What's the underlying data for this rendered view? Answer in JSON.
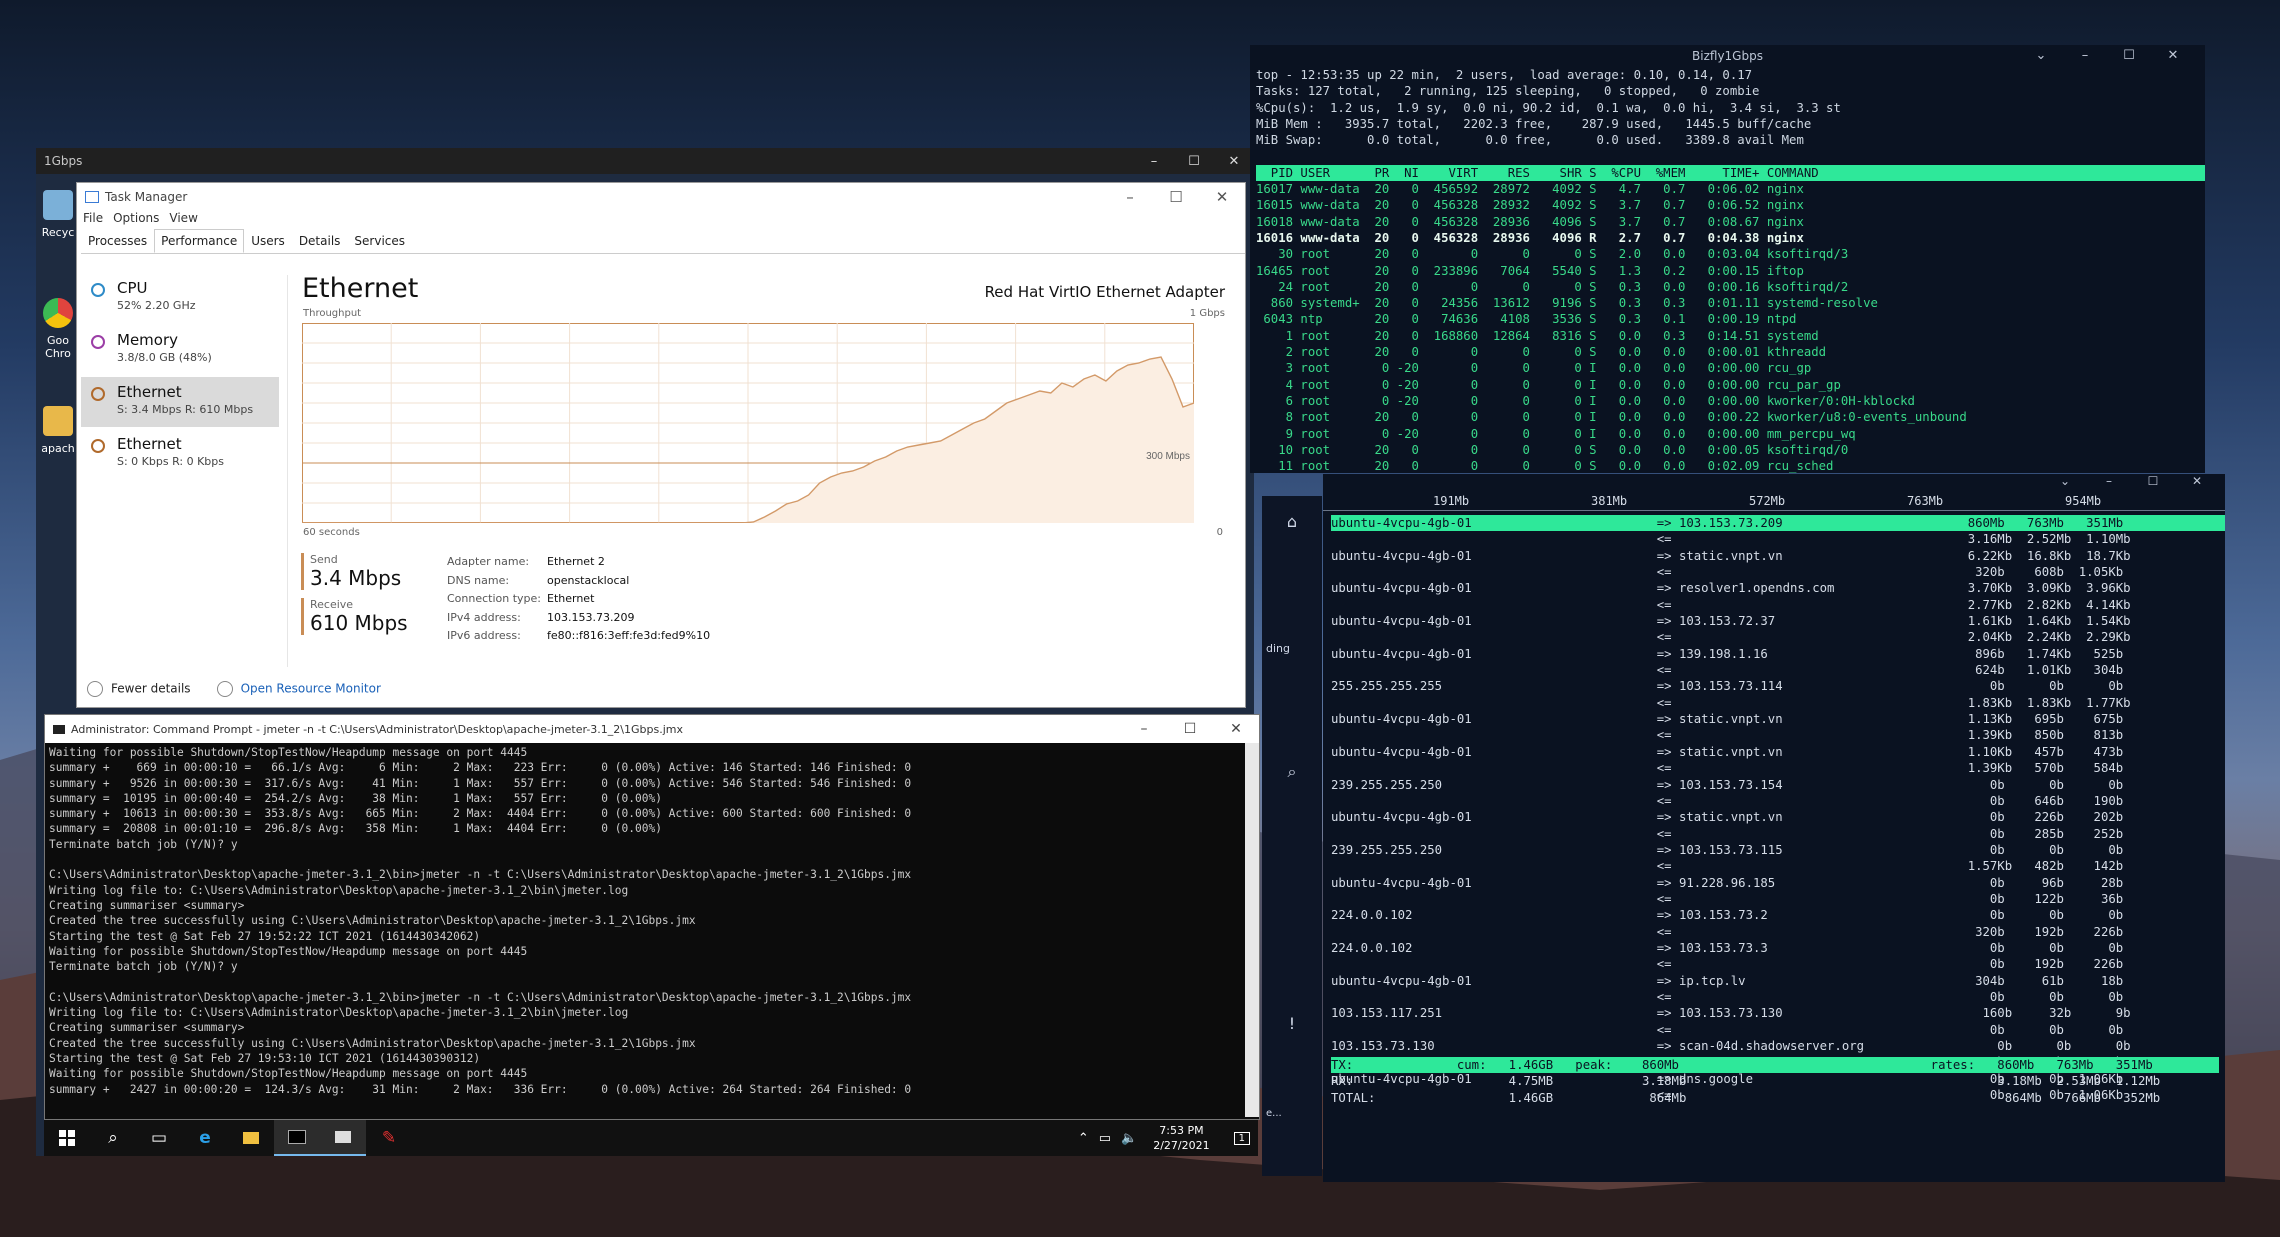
{
  "vm_window": {
    "title": "1Gbps"
  },
  "desktop_icons": [
    {
      "label": "Recyc",
      "color": "#7bb0d8"
    },
    {
      "label": "Goo\nChro",
      "color": "#e0443e"
    },
    {
      "label": "apach",
      "color": "#e8b84a"
    }
  ],
  "task_manager": {
    "title": "Task Manager",
    "menu": [
      "File",
      "Options",
      "View"
    ],
    "tabs": [
      "Processes",
      "Performance",
      "Users",
      "Details",
      "Services"
    ],
    "active_tab": "Performance",
    "resources": [
      {
        "name": "CPU",
        "sub": "52% 2.20 GHz",
        "ring": "#2e8bc8"
      },
      {
        "name": "Memory",
        "sub": "3.8/8.0 GB (48%)",
        "ring": "#9b3ea6"
      },
      {
        "name": "Ethernet",
        "sub": "S: 3.4 Mbps  R: 610 Mbps",
        "ring": "#b06a2c"
      },
      {
        "name": "Ethernet",
        "sub": "S: 0 Kbps  R: 0 Kbps",
        "ring": "#b06a2c"
      }
    ],
    "heading": "Ethernet",
    "adapter": "Red Hat VirtIO Ethernet Adapter",
    "throughput_label": "Throughput",
    "throughput_max": "1 Gbps",
    "scale_marker": "300 Mbps",
    "time_span": "60 seconds",
    "zero": "0",
    "send_label": "Send",
    "send_value": "3.4 Mbps",
    "receive_label": "Receive",
    "receive_value": "610 Mbps",
    "details": [
      {
        "k": "Adapter name:",
        "v": "Ethernet 2"
      },
      {
        "k": "DNS name:",
        "v": "openstacklocal"
      },
      {
        "k": "Connection type:",
        "v": "Ethernet"
      },
      {
        "k": "IPv4 address:",
        "v": "103.153.73.209"
      },
      {
        "k": "IPv6 address:",
        "v": "fe80::f816:3eff:fe3d:fed9%10"
      }
    ],
    "fewer_details": "Fewer details",
    "open_monitor": "Open Resource Monitor",
    "graph_mbps": [
      0,
      0,
      0,
      0,
      0,
      0,
      0,
      0,
      0,
      0,
      0,
      0,
      0,
      0,
      0,
      0,
      0,
      0,
      0,
      0,
      0,
      0,
      0,
      0,
      0,
      0,
      0,
      0,
      0,
      0,
      0,
      0,
      0,
      0,
      0,
      0,
      0,
      0,
      0,
      0,
      0,
      5,
      30,
      60,
      95,
      110,
      140,
      200,
      230,
      250,
      260,
      280,
      310,
      330,
      360,
      380,
      390,
      400,
      410,
      440,
      470,
      500,
      520,
      560,
      600,
      620,
      640,
      660,
      650,
      700,
      680,
      720,
      740,
      710,
      760,
      790,
      800,
      820,
      830,
      720,
      580,
      600
    ]
  },
  "cmd": {
    "title": "Administrator: Command Prompt - jmeter  -n -t C:\\Users\\Administrator\\Desktop\\apache-jmeter-3.1_2\\1Gbps.jmx",
    "lines": [
      "Waiting for possible Shutdown/StopTestNow/Heapdump message on port 4445",
      "summary +    669 in 00:00:10 =   66.1/s Avg:     6 Min:     2 Max:   223 Err:     0 (0.00%) Active: 146 Started: 146 Finished: 0",
      "summary +   9526 in 00:00:30 =  317.6/s Avg:    41 Min:     1 Max:   557 Err:     0 (0.00%) Active: 546 Started: 546 Finished: 0",
      "summary =  10195 in 00:00:40 =  254.2/s Avg:    38 Min:     1 Max:   557 Err:     0 (0.00%)",
      "summary +  10613 in 00:00:30 =  353.8/s Avg:   665 Min:     2 Max:  4404 Err:     0 (0.00%) Active: 600 Started: 600 Finished: 0",
      "summary =  20808 in 00:01:10 =  296.8/s Avg:   358 Min:     1 Max:  4404 Err:     0 (0.00%)",
      "Terminate batch job (Y/N)? y",
      "",
      "C:\\Users\\Administrator\\Desktop\\apache-jmeter-3.1_2\\bin>jmeter -n -t C:\\Users\\Administrator\\Desktop\\apache-jmeter-3.1_2\\1Gbps.jmx",
      "Writing log file to: C:\\Users\\Administrator\\Desktop\\apache-jmeter-3.1_2\\bin\\jmeter.log",
      "Creating summariser <summary>",
      "Created the tree successfully using C:\\Users\\Administrator\\Desktop\\apache-jmeter-3.1_2\\1Gbps.jmx",
      "Starting the test @ Sat Feb 27 19:52:22 ICT 2021 (1614430342062)",
      "Waiting for possible Shutdown/StopTestNow/Heapdump message on port 4445",
      "Terminate batch job (Y/N)? y",
      "",
      "C:\\Users\\Administrator\\Desktop\\apache-jmeter-3.1_2\\bin>jmeter -n -t C:\\Users\\Administrator\\Desktop\\apache-jmeter-3.1_2\\1Gbps.jmx",
      "Writing log file to: C:\\Users\\Administrator\\Desktop\\apache-jmeter-3.1_2\\bin\\jmeter.log",
      "Creating summariser <summary>",
      "Created the tree successfully using C:\\Users\\Administrator\\Desktop\\apache-jmeter-3.1_2\\1Gbps.jmx",
      "Starting the test @ Sat Feb 27 19:53:10 ICT 2021 (1614430390312)",
      "Waiting for possible Shutdown/StopTestNow/Heapdump message on port 4445",
      "summary +   2427 in 00:00:20 =  124.3/s Avg:    31 Min:     2 Max:   336 Err:     0 (0.00%) Active: 264 Started: 264 Finished: 0"
    ]
  },
  "taskbar": {
    "time": "7:53 PM",
    "date": "2/27/2021",
    "notif_count": "1"
  },
  "top_window": {
    "title": "Bizfly1Gbps",
    "summary": [
      "top - 12:53:35 up 22 min,  2 users,  load average: 0.10, 0.14, 0.17",
      "Tasks: 127 total,   2 running, 125 sleeping,   0 stopped,   0 zombie",
      "%Cpu(s):  1.2 us,  1.9 sy,  0.0 ni, 90.2 id,  0.1 wa,  0.0 hi,  3.4 si,  3.3 st",
      "MiB Mem :   3935.7 total,   2202.3 free,    287.9 used,   1445.5 buff/cache",
      "MiB Swap:      0.0 total,      0.0 free,      0.0 used.   3389.8 avail Mem"
    ],
    "header": "  PID USER      PR  NI    VIRT    RES    SHR S  %CPU  %MEM     TIME+ COMMAND                                      ",
    "rows": [
      "16017 www-data  20   0  456592  28972   4092 S   4.7   0.7   0:06.02 nginx",
      "16015 www-data  20   0  456328  28932   4092 S   3.7   0.7   0:06.52 nginx",
      "16018 www-data  20   0  456328  28936   4096 S   3.7   0.7   0:08.67 nginx",
      "16016 www-data  20   0  456328  28936   4096 R   2.7   0.7   0:04.38 nginx",
      "   30 root      20   0       0      0      0 S   2.0   0.0   0:03.04 ksoftirqd/3",
      "16465 root      20   0  233896   7064   5540 S   1.3   0.2   0:00.15 iftop",
      "   24 root      20   0       0      0      0 S   0.3   0.0   0:00.16 ksoftirqd/2",
      "  860 systemd+  20   0   24356  13612   9196 S   0.3   0.3   0:01.11 systemd-resolve",
      " 6043 ntp       20   0   74636   4108   3536 S   0.3   0.1   0:00.19 ntpd",
      "    1 root      20   0  168860  12864   8316 S   0.0   0.3   0:14.51 systemd",
      "    2 root      20   0       0      0      0 S   0.0   0.0   0:00.01 kthreadd",
      "    3 root       0 -20       0      0      0 I   0.0   0.0   0:00.00 rcu_gp",
      "    4 root       0 -20       0      0      0 I   0.0   0.0   0:00.00 rcu_par_gp",
      "    6 root       0 -20       0      0      0 I   0.0   0.0   0:00.00 kworker/0:0H-kblockd",
      "    8 root      20   0       0      0      0 I   0.0   0.0   0:00.22 kworker/u8:0-events_unbound",
      "    9 root       0 -20       0      0      0 I   0.0   0.0   0:00.00 mm_percpu_wq",
      "   10 root      20   0       0      0      0 S   0.0   0.0   0:00.05 ksoftirqd/0",
      "   11 root      20   0       0      0      0 S   0.0   0.0   0:02.09 rcu_sched"
    ]
  },
  "iftop": {
    "scale": [
      "191Mb",
      "381Mb",
      "572Mb",
      "763Mb",
      "954Mb"
    ],
    "lines": [
      "ubuntu-4vcpu-4gb-01                         => 103.153.73.209                         860Mb   763Mb   351Mb",
      "                                            <=                                        3.16Mb  2.52Mb  1.10Mb",
      "ubuntu-4vcpu-4gb-01                         => static.vnpt.vn                         6.22Kb  16.8Kb  18.7Kb",
      "                                            <=                                         320b    608b  1.05Kb",
      "ubuntu-4vcpu-4gb-01                         => resolver1.opendns.com                  3.70Kb  3.09Kb  3.96Kb",
      "                                            <=                                        2.77Kb  2.82Kb  4.14Kb",
      "ubuntu-4vcpu-4gb-01                         => 103.153.72.37                          1.61Kb  1.64Kb  1.54Kb",
      "                                            <=                                        2.04Kb  2.24Kb  2.29Kb",
      "ubuntu-4vcpu-4gb-01                         => 139.198.1.16                            896b   1.74Kb   525b",
      "                                            <=                                         624b   1.01Kb   304b",
      "255.255.255.255                             => 103.153.73.114                            0b      0b      0b",
      "                                            <=                                        1.83Kb  1.83Kb  1.77Kb",
      "ubuntu-4vcpu-4gb-01                         => static.vnpt.vn                         1.13Kb   695b    675b",
      "                                            <=                                        1.39Kb   850b    813b",
      "ubuntu-4vcpu-4gb-01                         => static.vnpt.vn                         1.10Kb   457b    473b",
      "                                            <=                                        1.39Kb   570b    584b",
      "239.255.255.250                             => 103.153.73.154                            0b      0b      0b",
      "                                            <=                                           0b    646b    190b",
      "ubuntu-4vcpu-4gb-01                         => static.vnpt.vn                            0b    226b    202b",
      "                                            <=                                           0b    285b    252b",
      "239.255.255.250                             => 103.153.73.115                            0b      0b      0b",
      "                                            <=                                        1.57Kb   482b    142b",
      "ubuntu-4vcpu-4gb-01                         => 91.228.96.185                             0b     96b     28b",
      "                                            <=                                           0b    122b     36b",
      "224.0.0.102                                 => 103.153.73.2                              0b      0b      0b",
      "                                            <=                                         320b    192b    226b",
      "224.0.0.102                                 => 103.153.73.3                              0b      0b      0b",
      "                                            <=                                           0b    192b    226b",
      "ubuntu-4vcpu-4gb-01                         => ip.tcp.lv                               304b     61b     18b",
      "                                            <=                                           0b      0b      0b",
      "103.153.117.251                             => 103.153.73.130                           160b     32b      9b",
      "                                            <=                                           0b      0b      0b",
      "103.153.73.130                              => scan-04d.shadowserver.org                  0b      0b      0b",
      "                                            <=                                           0b     32b      9b",
      "ubuntu-4vcpu-4gb-01                         => dns.google                                0b      0b  1.06Kb",
      "                                            <=                                           0b      0b  1.06Kb"
    ],
    "footer": [
      "TX:              cum:   1.46GB   peak:    860Mb                                  rates:   860Mb   763Mb   351Mb",
      "RX:                     4.75MB            3.18Mb                                          3.18Mb  2.53Mb  1.12Mb",
      "TOTAL:                  1.46GB             864Mb                                           864Mb   766Mb   352Mb"
    ],
    "side_text": [
      "ding",
      "!",
      "e..."
    ]
  }
}
